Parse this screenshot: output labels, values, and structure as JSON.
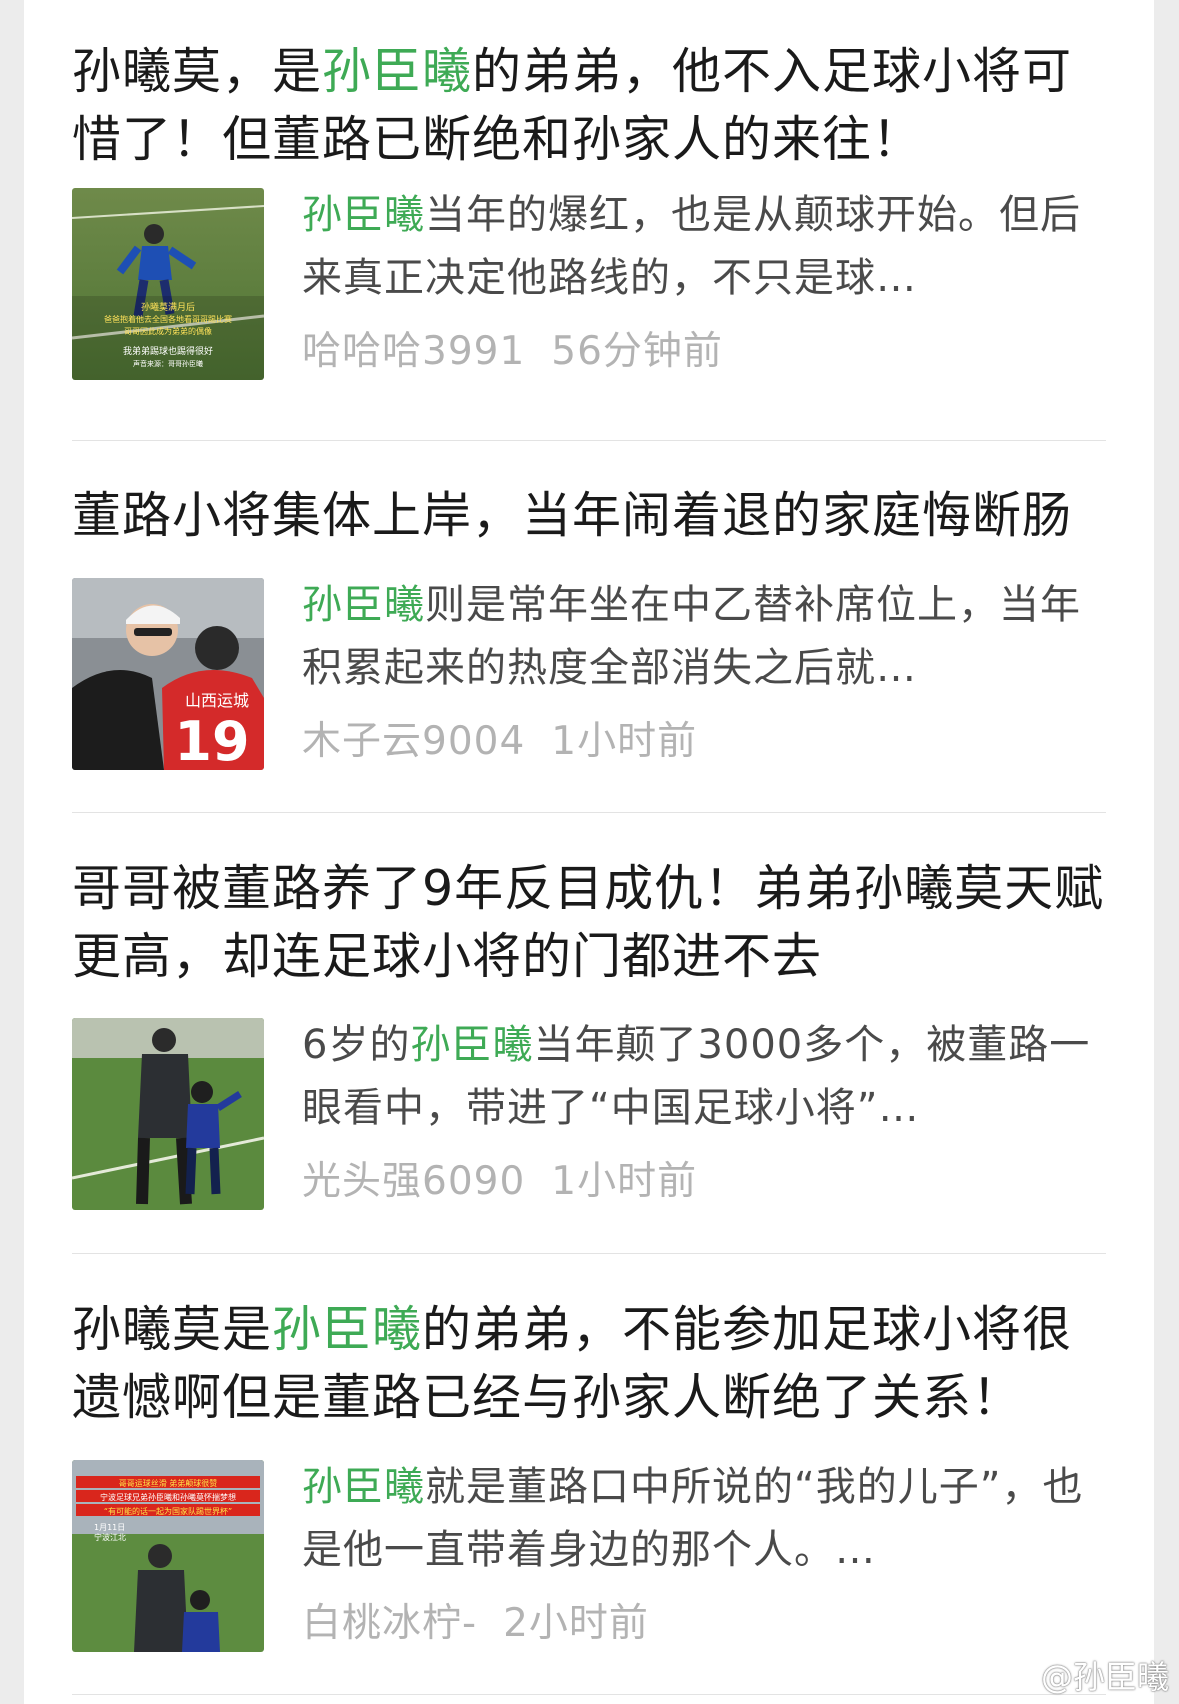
{
  "articles": [
    {
      "title_before": "孙曦莫，是",
      "title_highlight": "孙臣曦",
      "title_after": "的弟弟，他不入足球小将可惜了！但董路已断绝和孙家人的来往！",
      "snippet_before": "",
      "snippet_highlight": "孙臣曦",
      "snippet_after": "当年的爆红，也是从颠球开始。但后来真正决定他路线的，不只是球…",
      "source": "哈哈哈3991",
      "time": "56分钟前",
      "thumb_caption_1": "孙曦莫满月后",
      "thumb_caption_2": "爸爸抱着他去全国各地看哥哥踢比赛",
      "thumb_caption_3": "哥哥因此成为弟弟的偶像",
      "thumb_caption_4": "我弟弟踢球也踢得很好",
      "thumb_caption_5": "声音来源：哥哥孙臣曦"
    },
    {
      "title_before": "董路小将集体上岸，当年闹着退的家庭悔断肠",
      "title_highlight": "",
      "title_after": "",
      "snippet_before": "",
      "snippet_highlight": "孙臣曦",
      "snippet_after": "则是常年坐在中乙替补席位上，当年积累起来的热度全部消失之后就…",
      "source": "木子云9004",
      "time": "1小时前",
      "jersey_text": "山西运城",
      "jersey_number": "19"
    },
    {
      "title_before": "哥哥被董路养了9年反目成仇！弟弟孙曦莫天赋更高，却连足球小将的门都进不去",
      "title_highlight": "",
      "title_after": "",
      "snippet_before": "6岁的",
      "snippet_highlight": "孙臣曦",
      "snippet_after": "当年颠了3000多个，被董路一眼看中，带进了“中国足球小将”…",
      "source": "光头强6090",
      "time": "1小时前"
    },
    {
      "title_before": "孙曦莫是",
      "title_highlight": "孙臣曦",
      "title_after": "的弟弟，不能参加足球小将很遗憾啊但是董路已经与孙家人断绝了关系！",
      "snippet_before": "",
      "snippet_highlight": "孙臣曦",
      "snippet_after": "就是董路口中所说的“我的儿子”，也是他一直带着身边的那个人。…",
      "source": "白桃冰柠-",
      "time": "2小时前",
      "thumb_caption_1": "哥哥运球丝滑 弟弟颠球很赞",
      "thumb_caption_2": "宁波足球兄弟孙臣曦和孙曦莫怀揣梦想",
      "thumb_caption_3": "“有可能的话一起为国家队踢世界杯”",
      "thumb_caption_4": "1月11日",
      "thumb_caption_5": "宁波江北"
    }
  ],
  "watermark": "@孙臣曦",
  "colors": {
    "highlight": "#3eaa55",
    "title": "#1a1a1a",
    "meta": "#b3b3b3"
  }
}
